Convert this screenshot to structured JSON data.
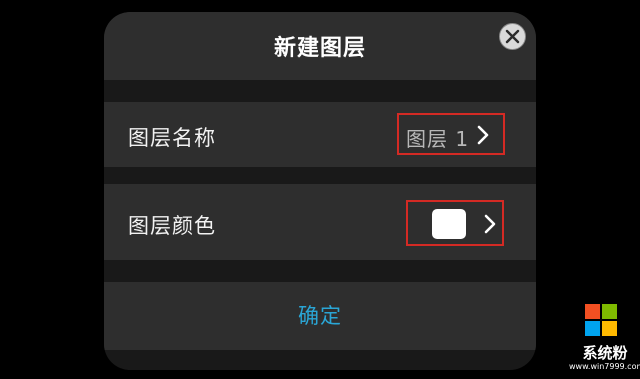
{
  "dialog": {
    "title": "新建图层",
    "close_icon": "close-icon",
    "rows": [
      {
        "label": "图层名称",
        "value": "图层 1",
        "icon": "chevron-right-icon"
      },
      {
        "label": "图层颜色",
        "swatch_color": "#ffffff",
        "icon": "chevron-right-icon"
      }
    ],
    "confirm_label": "确定"
  },
  "colors": {
    "accent": "#2aa6d6",
    "highlight_border": "#d42a24",
    "panel": "#2e2e2e",
    "background": "#000000"
  },
  "watermark": {
    "brand": "系统粉",
    "url": "www.win7999.com",
    "logo_icon": "windows-logo-icon"
  }
}
